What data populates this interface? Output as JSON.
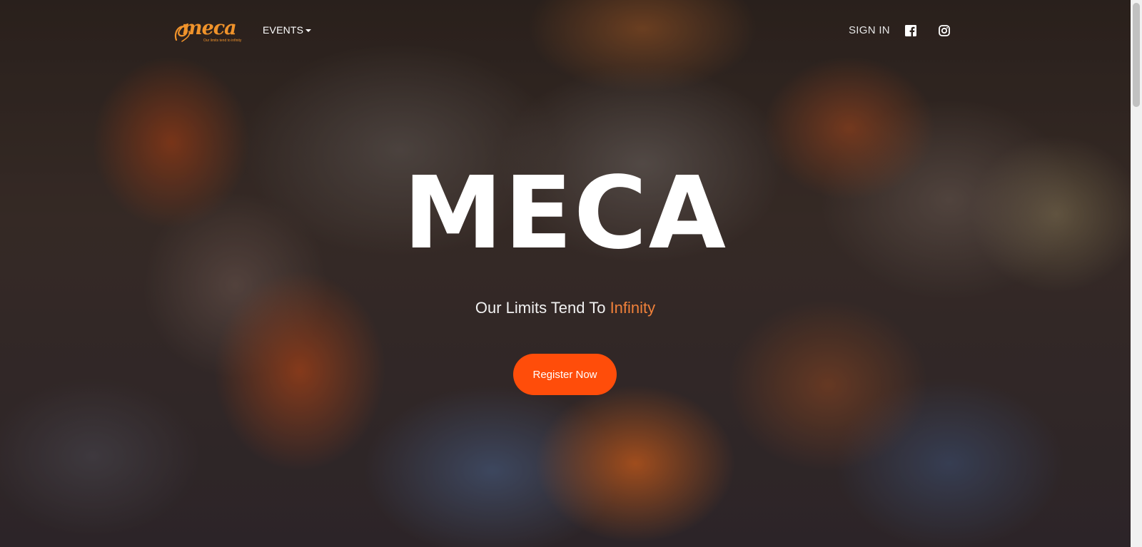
{
  "navbar": {
    "logo": {
      "word": "meca",
      "tagline": "Our limits tend to infinity"
    },
    "events_label": "EVENTS",
    "signin_label": "SIGN IN",
    "social": [
      {
        "name": "facebook-icon"
      },
      {
        "name": "instagram-icon"
      }
    ]
  },
  "hero": {
    "title": "MECA",
    "subtitle_prefix": "Our Limits Tend To ",
    "subtitle_accent": "Infinity",
    "cta_label": "Register Now"
  },
  "colors": {
    "accent": "#ff4d0a",
    "subtitle_accent": "#f0813a",
    "logo": "#f0932b"
  }
}
